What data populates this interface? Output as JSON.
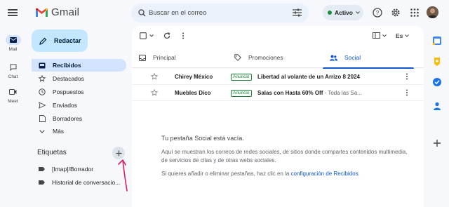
{
  "rail": {
    "items": [
      {
        "label": "Mail",
        "icon": "mail-icon",
        "active": true
      },
      {
        "label": "Chat",
        "icon": "chat-icon",
        "active": false
      },
      {
        "label": "Meet",
        "icon": "video-icon",
        "active": false
      }
    ]
  },
  "header": {
    "app_name": "Gmail",
    "search_placeholder": "Buscar en el correo",
    "status_label": "Activo"
  },
  "sidebar": {
    "compose_label": "Redactar",
    "items": [
      {
        "label": "Recibidos",
        "icon": "inbox-icon",
        "active": true
      },
      {
        "label": "Destacados",
        "icon": "star-icon",
        "active": false
      },
      {
        "label": "Pospuestos",
        "icon": "clock-icon",
        "active": false
      },
      {
        "label": "Enviados",
        "icon": "send-icon",
        "active": false
      },
      {
        "label": "Borradores",
        "icon": "draft-icon",
        "active": false
      },
      {
        "label": "Más",
        "icon": "chevron-down-icon",
        "active": false
      }
    ],
    "labels_title": "Etiquetas",
    "labels": [
      {
        "label": "[Imap]/Borrador"
      },
      {
        "label": "Historial de conversacio..."
      }
    ]
  },
  "toolbar": {
    "lang_label": "Es"
  },
  "tabs": [
    {
      "label": "Principal",
      "icon": "inbox-icon",
      "active": false
    },
    {
      "label": "Promociones",
      "icon": "tag-icon",
      "active": false
    },
    {
      "label": "Social",
      "icon": "people-icon",
      "active": true
    }
  ],
  "emails": [
    {
      "from": "Chirey México",
      "badge": "Anuncio",
      "subject": "Libertad al volante de un Arrizo 8 2024",
      "snippet": ""
    },
    {
      "from": "Muebles Dico",
      "badge": "Anuncio",
      "subject": "Salas con Hasta 60% Off",
      "snippet": " - Toda las Sa..."
    }
  ],
  "empty_state": {
    "title": "Tu pestaña Social está vacía.",
    "description": "Aquí se muestran los correos de redes sociales, de sitios donde compartes contenidos multimedia, de servicios de citas y de otras webs sociales.",
    "hint_prefix": "Si quieres añadir o eliminar pestañas, haz clic en la ",
    "hint_link": "configuración de Recibidos",
    "hint_suffix": "."
  },
  "colors": {
    "accent": "#0b57d0",
    "compose_bg": "#c2e7ff",
    "active_nav_bg": "#d3e3fd",
    "status_green": "#1e8e3e",
    "ad_green": "#188038",
    "arrow_annotation": "#d61f69"
  }
}
